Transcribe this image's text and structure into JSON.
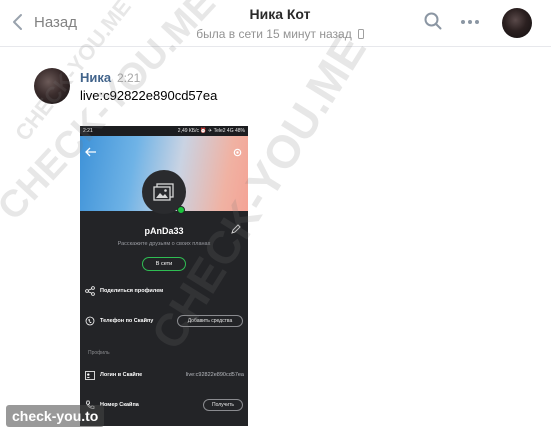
{
  "header": {
    "back_label": "Назад",
    "peer_name": "Ника Кот",
    "peer_status": "была в сети 15 минут назад"
  },
  "message": {
    "author": "Ника",
    "time": "2:21",
    "text": "live:c92822e890cd57ea"
  },
  "screenshot": {
    "status_left": "2:21",
    "status_right": "2,49 КБ/с  ⏰ ✈ Tele2 4G  48%",
    "username": "pAnDa33",
    "tagline": "Расскажите друзьям о своих планах",
    "online_button": "В сети",
    "share_profile": "Поделиться профилем",
    "skype_phone": "Телефон по Скайпу",
    "add_funds_button": "Добавить средства",
    "section_profile": "Профиль",
    "skype_login_label": "Логин в Скайпе",
    "skype_login_value": "live:c92822e890cd57ea",
    "skype_number_label": "Номер Скайпа",
    "get_button": "Получить"
  },
  "watermark": {
    "badge": "check-you.to",
    "diag1": "CHECK-YOU.ME",
    "diag2": "CHECK-YOU.ME",
    "diag3": "CHECK-YOU.ME"
  },
  "colors": {
    "author_link": "#42648b",
    "online_green": "#1bc53d",
    "screenshot_bg": "#232427"
  }
}
